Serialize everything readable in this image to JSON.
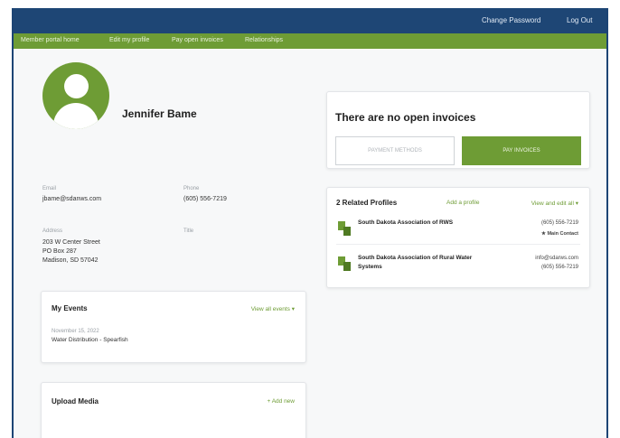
{
  "header": {
    "change_password": "Change Password",
    "log_out": "Log Out"
  },
  "nav": {
    "items": [
      "Member portal home",
      "Edit my profile",
      "Pay open invoices",
      "Relationships"
    ]
  },
  "profile": {
    "name": "Jennifer Bame",
    "email_label": "Email",
    "email": "jbame@sdanws.com",
    "phone_label": "Phone",
    "phone": "(605) 556-7219",
    "address_label": "Address",
    "address_lines": [
      "203 W Center Street",
      "PO Box 287",
      "Madison, SD 57042"
    ],
    "title_label": "Title"
  },
  "events": {
    "title": "My Events",
    "view_all": "View all events ▾",
    "date": "November 15, 2022",
    "event_name": "Water Distribution - Spearfish"
  },
  "media": {
    "title": "Upload Media",
    "add_new": "+ Add new"
  },
  "invoices": {
    "title": "There are no open invoices",
    "payment_methods": "PAYMENT METHODS",
    "pay_invoices": "PAY INVOICES"
  },
  "related": {
    "title": "2 Related Profiles",
    "add_profile": "Add a profile",
    "view_edit_all": "View and edit all ▾",
    "items": [
      {
        "name": "South Dakota Association of RWS",
        "phone": "(605) 556-7219",
        "badge": "★ Main Contact"
      },
      {
        "name_line1": "South Dakota Association of Rural Water",
        "name_line2": "Systems",
        "email": "info@sdarws.com",
        "phone": "(605) 556-7219"
      }
    ]
  },
  "colors": {
    "header": "#1e4675",
    "accent": "#6e9c35"
  }
}
